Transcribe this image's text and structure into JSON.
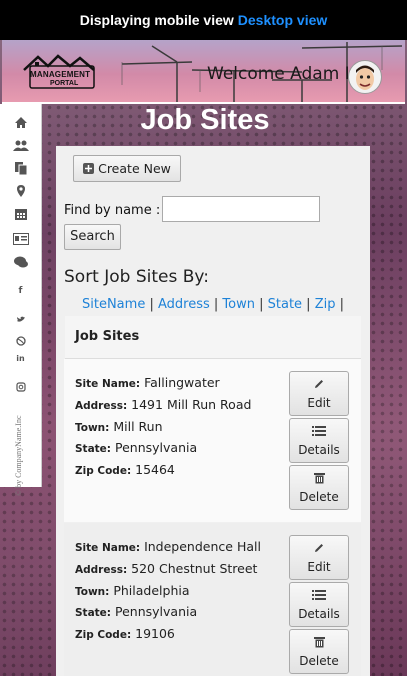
{
  "topbar": {
    "text": "Displaying mobile view",
    "link": "Desktop view"
  },
  "header": {
    "logo_line1": "MANAGEMENT",
    "logo_line2": "PORTAL",
    "welcome": "Welcome Adam I"
  },
  "sidebar": {
    "icons": [
      "home-icon",
      "users-icon",
      "documents-icon",
      "map-marker-icon",
      "calendar-icon",
      "id-card-icon",
      "comments-icon",
      "facebook-icon",
      "twitter-icon",
      "dribbble-icon",
      "linkedin-icon",
      "instagram-icon"
    ],
    "copyright": "© by CompanyName.Inc"
  },
  "page": {
    "title": "Job Sites",
    "create_new": "Create New",
    "find_label": "Find by name :",
    "find_value": "",
    "search": "Search",
    "sort_title": "Sort Job Sites By:",
    "sort_links": [
      "SiteName",
      "Address",
      "Town",
      "State",
      "Zip"
    ],
    "list_header": "Job Sites"
  },
  "field_labels": {
    "site_name": "Site Name:",
    "address": "Address:",
    "town": "Town:",
    "state": "State:",
    "zip": "Zip Code:"
  },
  "actions": {
    "edit": "Edit",
    "details": "Details",
    "delete": "Delete"
  },
  "sites": [
    {
      "site_name": "Fallingwater",
      "address": "1491 Mill Run Road",
      "town": "Mill Run",
      "state": "Pennsylvania",
      "zip": "15464"
    },
    {
      "site_name": "Independence Hall",
      "address": "520 Chestnut Street",
      "town": "Philadelphia",
      "state": "Pennsylvania",
      "zip": "19106"
    }
  ]
}
